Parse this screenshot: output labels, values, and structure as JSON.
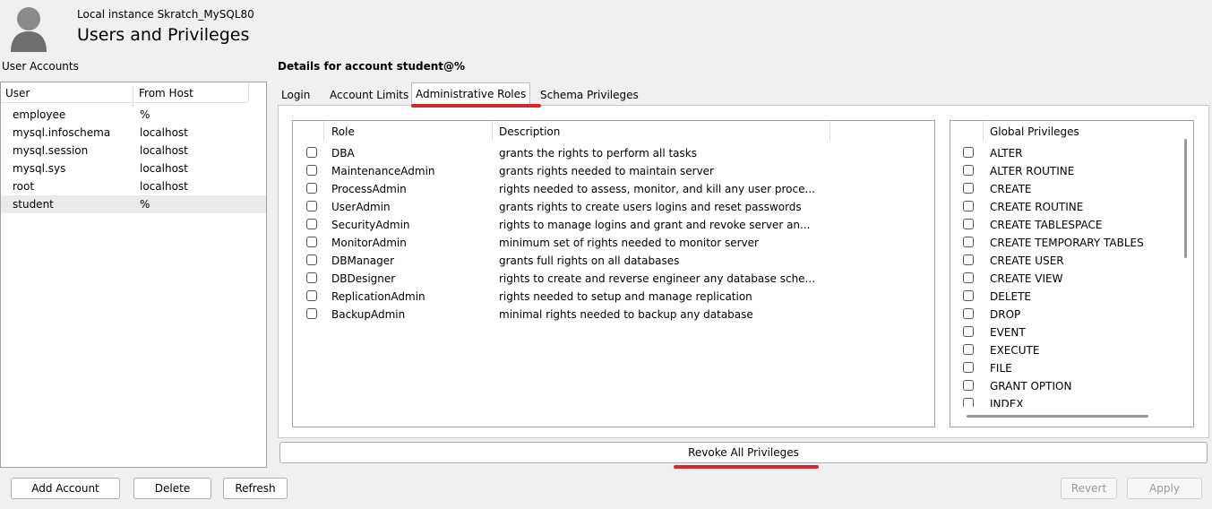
{
  "header": {
    "subtitle": "Local instance Skratch_MySQL80",
    "title": "Users and Privileges"
  },
  "user_accounts": {
    "label": "User Accounts",
    "columns": [
      "User",
      "From Host"
    ],
    "rows": [
      {
        "user": "employee",
        "host": "%"
      },
      {
        "user": "mysql.infoschema",
        "host": "localhost"
      },
      {
        "user": "mysql.session",
        "host": "localhost"
      },
      {
        "user": "mysql.sys",
        "host": "localhost"
      },
      {
        "user": "root",
        "host": "localhost"
      },
      {
        "user": "student",
        "host": "%"
      }
    ],
    "selected_user": "student"
  },
  "details": {
    "title": "Details for account student@%",
    "tabs": [
      "Login",
      "Account Limits",
      "Administrative Roles",
      "Schema Privileges"
    ],
    "active_tab": "Administrative Roles"
  },
  "roles": {
    "columns": [
      "Role",
      "Description"
    ],
    "rows": [
      {
        "role": "DBA",
        "description": "grants the rights to perform all tasks",
        "checked": false
      },
      {
        "role": "MaintenanceAdmin",
        "description": "grants rights needed to maintain server",
        "checked": false
      },
      {
        "role": "ProcessAdmin",
        "description": "rights needed to assess, monitor, and kill any user proce...",
        "checked": false
      },
      {
        "role": "UserAdmin",
        "description": "grants rights to create users logins and reset passwords",
        "checked": false
      },
      {
        "role": "SecurityAdmin",
        "description": "rights to manage logins and grant and revoke server an...",
        "checked": false
      },
      {
        "role": "MonitorAdmin",
        "description": "minimum set of rights needed to monitor server",
        "checked": false
      },
      {
        "role": "DBManager",
        "description": "grants full rights on all databases",
        "checked": false
      },
      {
        "role": "DBDesigner",
        "description": "rights to create and reverse engineer any database sche...",
        "checked": false
      },
      {
        "role": "ReplicationAdmin",
        "description": "rights needed to setup and manage replication",
        "checked": false
      },
      {
        "role": "BackupAdmin",
        "description": "minimal rights needed to backup any database",
        "checked": false
      }
    ]
  },
  "global_privileges": {
    "header": "Global Privileges",
    "items": [
      "ALTER",
      "ALTER ROUTINE",
      "CREATE",
      "CREATE ROUTINE",
      "CREATE TABLESPACE",
      "CREATE TEMPORARY TABLES",
      "CREATE USER",
      "CREATE VIEW",
      "DELETE",
      "DROP",
      "EVENT",
      "EXECUTE",
      "FILE",
      "GRANT OPTION",
      "INDEX"
    ]
  },
  "buttons": {
    "revoke": "Revoke All Privileges",
    "add_account": "Add Account",
    "delete": "Delete",
    "refresh": "Refresh",
    "revert": "Revert",
    "apply": "Apply"
  },
  "colors": {
    "highlight": "#d6262a",
    "background": "#f0f0f0"
  }
}
